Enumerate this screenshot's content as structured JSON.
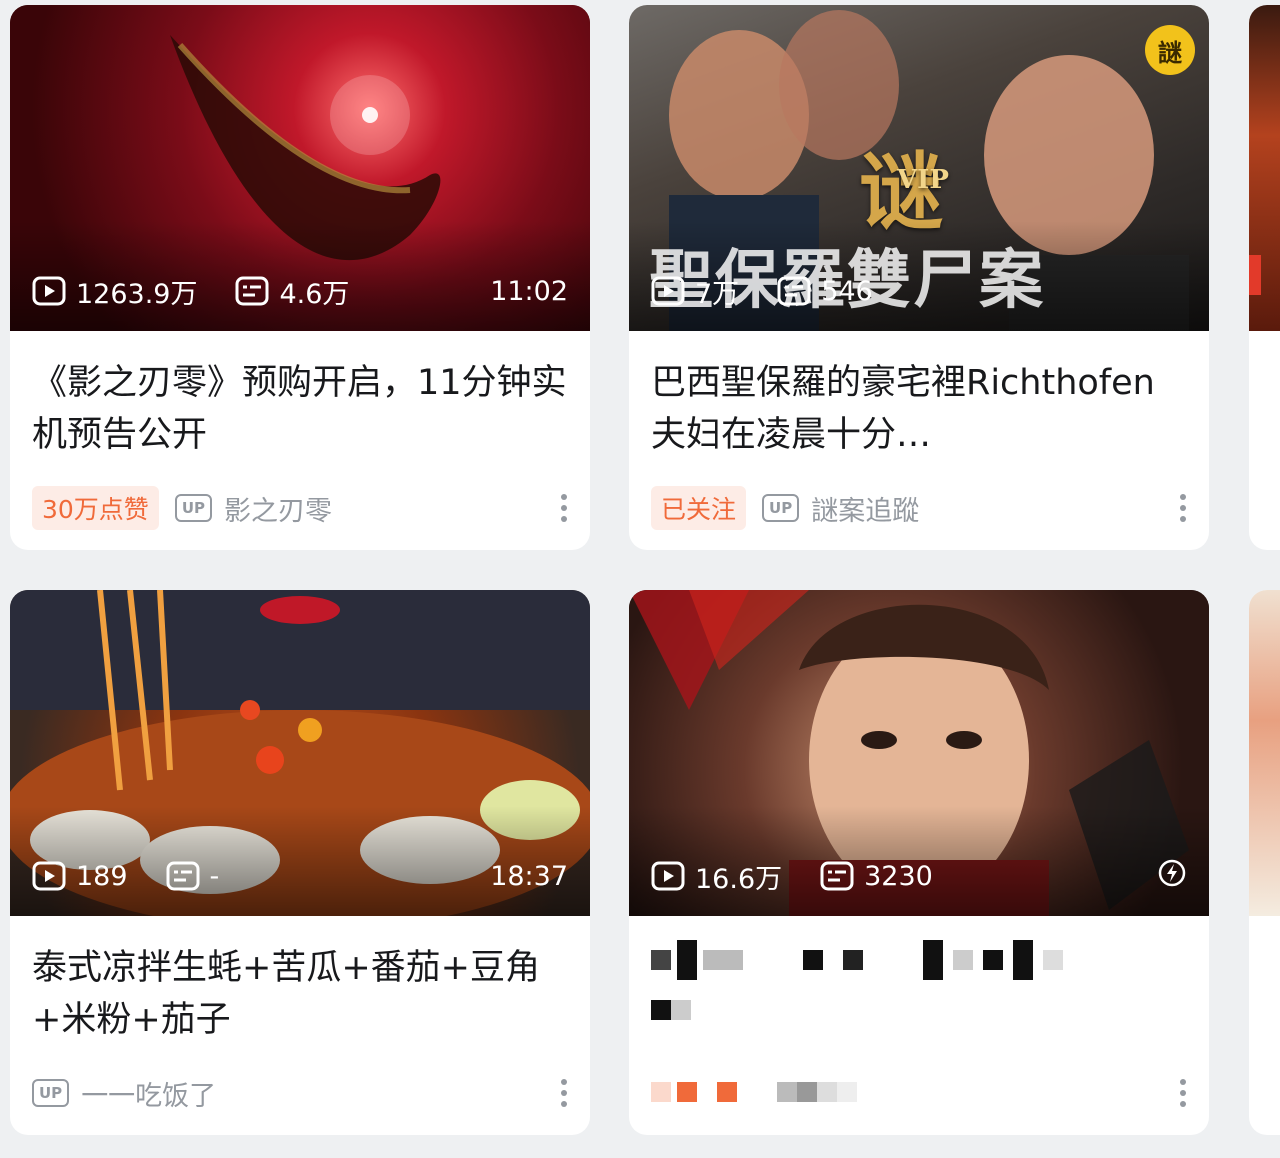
{
  "cards": [
    {
      "views": "1263.9万",
      "danmaku": "4.6万",
      "duration": "11:02",
      "title": "《影之刃零》预购开启，11分钟实机预告公开",
      "tag": "30万点赞",
      "up_label": "UP",
      "author": "影之刃零"
    },
    {
      "views": "7万",
      "danmaku": "546",
      "duration": "",
      "thumb_text": "聖保羅雙尸案",
      "vip_mark": "谜",
      "vip_sub": "VIP",
      "channel_badge": "謎",
      "title": "巴西聖保羅的豪宅裡Richthofen夫妇在凌晨十分…",
      "tag": "已关注",
      "up_label": "UP",
      "author": "謎案追蹤"
    },
    {
      "views": "189",
      "danmaku": "-",
      "duration": "18:37",
      "title": "泰式凉拌生蚝+苦瓜+番茄+豆角+米粉+茄子",
      "tag": "",
      "up_label": "UP",
      "author": "一一吃饭了"
    },
    {
      "views": "16.6万",
      "danmaku": "3230",
      "duration": "",
      "title": "",
      "tag": "",
      "up_label": "",
      "author": ""
    }
  ],
  "colors": {
    "background": "#eef0f2",
    "card": "#ffffff",
    "tag_bg": "#fdece6",
    "tag_text": "#f06a3a",
    "secondary_text": "#9499a0",
    "title_text": "#18191c"
  },
  "icons": {
    "views": "play-count-icon",
    "danmaku": "danmaku-count-icon",
    "more": "more-vertical-icon",
    "up": "up-badge-icon",
    "special": "lightning-icon"
  }
}
